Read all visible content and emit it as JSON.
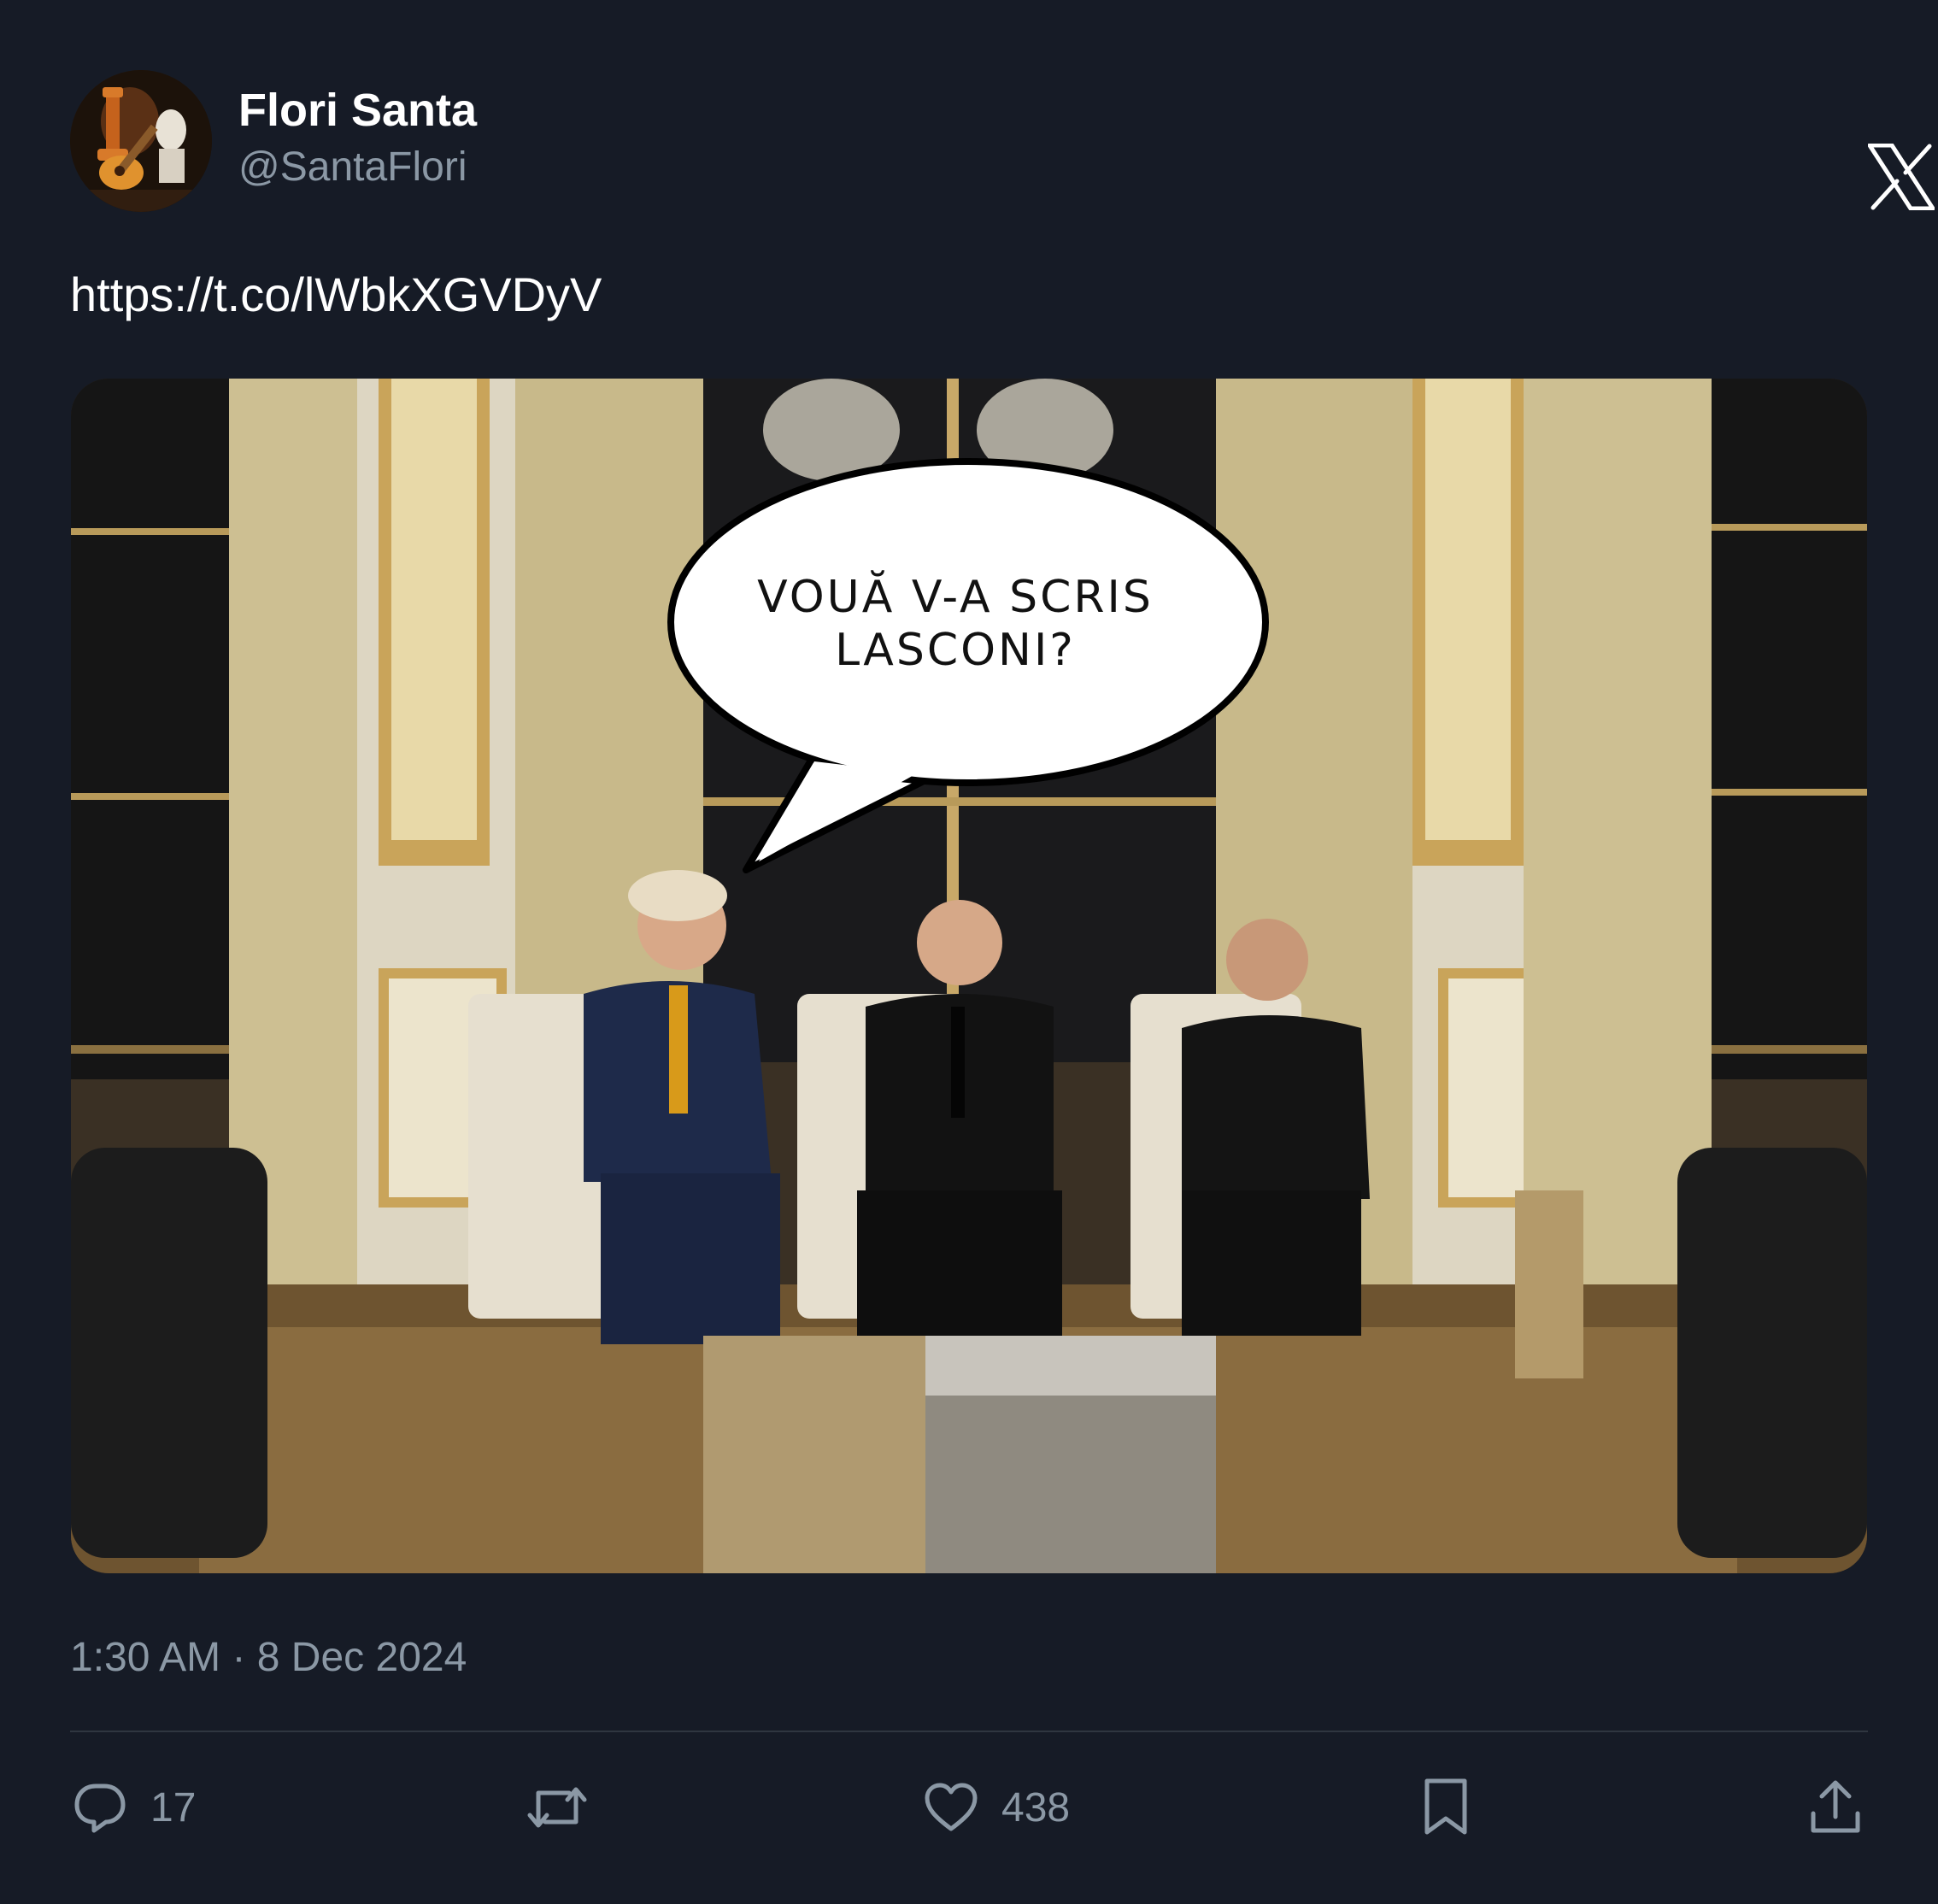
{
  "author": {
    "display_name": "Flori Santa",
    "handle": "@SantaFlori"
  },
  "tweet": {
    "text": "https://t.co/lWbkXGVDyV",
    "media": {
      "speech_bubble_lines": [
        "VOUĂ V-A SCRIS",
        "LASCONI?"
      ]
    },
    "timestamp": "1:30 AM · 8 Dec 2024"
  },
  "actions": {
    "reply_count": "17",
    "repost_count": "",
    "like_count": "438"
  },
  "icons": {
    "logo": "x-logo-icon",
    "reply": "reply-icon",
    "repost": "repost-icon",
    "like": "heart-icon",
    "bookmark": "bookmark-icon",
    "share": "share-icon"
  },
  "colors": {
    "background": "#161b26",
    "primary_text": "#ffffff",
    "secondary_text": "#8b98a5",
    "divider": "#2f3640"
  }
}
